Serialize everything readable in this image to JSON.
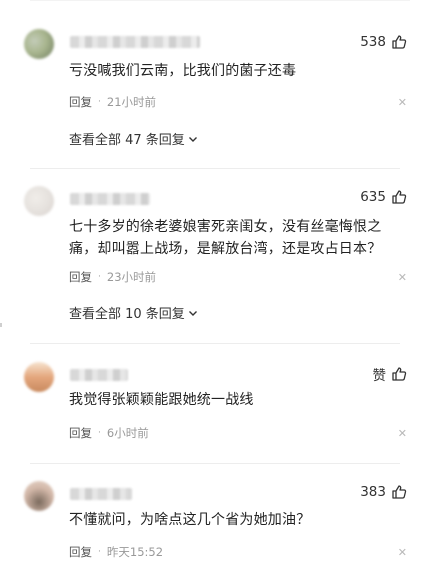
{
  "comments": [
    {
      "likes": "538",
      "text": "亏没喊我们云南，比我们的菌子还毒",
      "reply_label": "回复",
      "time": "21小时前",
      "more_replies": "查看全部 47 条回复",
      "avatar_colors": [
        "#a8b58e",
        "#6e7c5f",
        "#c3ccb8"
      ]
    },
    {
      "likes": "635",
      "text": "七十多岁的徐老婆娘害死亲闺女，没有丝毫悔恨之痛，却叫嚣上战场，是解放台湾，还是攻占日本？",
      "reply_label": "回复",
      "time": "23小时前",
      "more_replies": "查看全部 10 条回复",
      "avatar_colors": [
        "#e6e2de",
        "#d9d3cf",
        "#f0ede9"
      ]
    },
    {
      "likes": "赞",
      "text": "我觉得张颖颖能跟她统一战线",
      "reply_label": "回复",
      "time": "6小时前",
      "avatar_colors": [
        "#e4a77d",
        "#f0c9a3",
        "#c98a5e"
      ]
    },
    {
      "likes": "383",
      "text": "不懂就问，为啥点这几个省为她加油？",
      "reply_label": "回复",
      "time": "昨天15:52",
      "avatar_colors": [
        "#d2b7a8",
        "#7a6a5d",
        "#e8d8cc"
      ]
    }
  ],
  "icons": {
    "like": "thumbs-up-icon",
    "close": "close-icon",
    "expand": "chevron-down-icon"
  }
}
